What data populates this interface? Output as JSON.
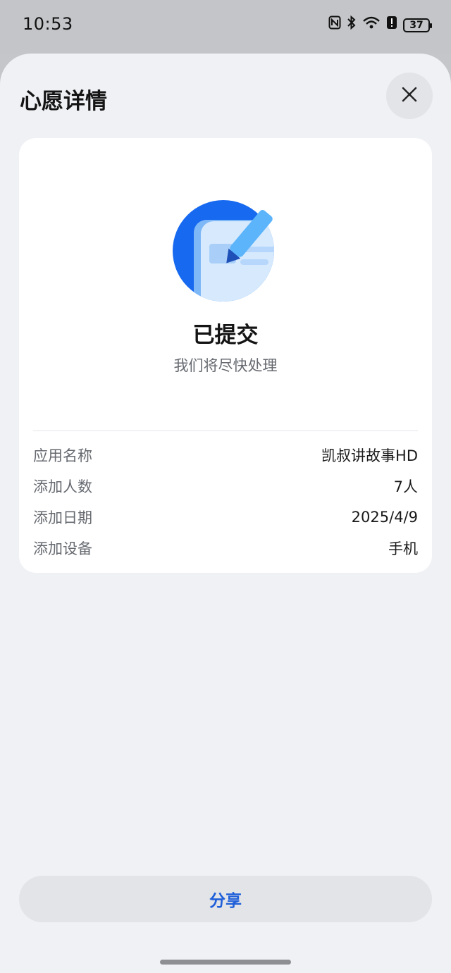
{
  "status_bar": {
    "time": "10:53",
    "battery": "37",
    "icons": [
      "nfc-icon",
      "bluetooth-icon",
      "wifi-icon",
      "alert-icon",
      "battery-icon"
    ]
  },
  "sheet": {
    "title": "心愿详情",
    "close_icon": "close-icon"
  },
  "status": {
    "icon": "edit-document-icon",
    "title": "已提交",
    "subtitle": "我们将尽快处理"
  },
  "details": [
    {
      "label": "应用名称",
      "value": "凯叔讲故事HD"
    },
    {
      "label": "添加人数",
      "value": "7人"
    },
    {
      "label": "添加日期",
      "value": "2025/4/9"
    },
    {
      "label": "添加设备",
      "value": "手机"
    }
  ],
  "share": {
    "label": "分享"
  },
  "colors": {
    "accent": "#1f5fd9",
    "background": "#f0f1f5",
    "card": "#ffffff"
  }
}
